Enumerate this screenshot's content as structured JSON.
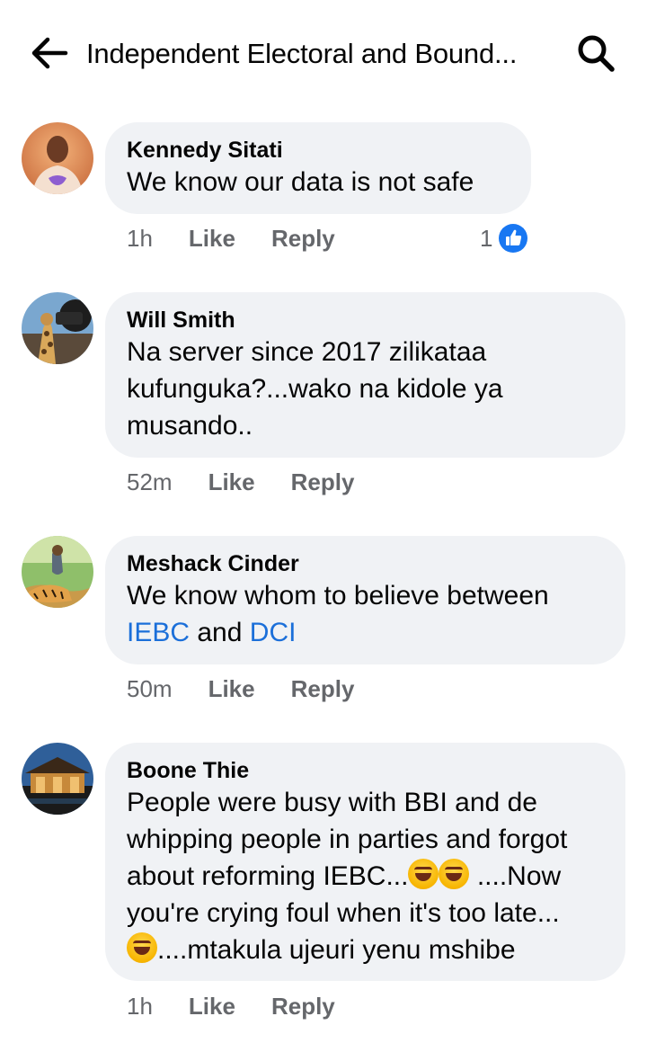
{
  "header": {
    "title": "Independent Electoral and Bound..."
  },
  "comments": [
    {
      "author": "Kennedy Sitati",
      "text": "We know our data is not safe",
      "time": "1h",
      "like_label": "Like",
      "reply_label": "Reply",
      "reaction_count": "1"
    },
    {
      "author": "Will Smith",
      "lines": [
        "Na server since 2017 zilikataa",
        "kufunguka?...wako na kidole ya",
        "musando.."
      ],
      "time": "52m",
      "like_label": "Like",
      "reply_label": "Reply"
    },
    {
      "author": "Meshack Cinder",
      "line1": "We know whom to believe between",
      "link1": "IEBC",
      "joiner": "and",
      "link2": "DCI",
      "time": "50m",
      "like_label": "Like",
      "reply_label": "Reply"
    },
    {
      "author": "Boone Thie",
      "lines": [
        "People were busy with BBI and de",
        "whipping people in parties and forgot",
        "about reforming IEBC...",
        " ....Now",
        "you're crying foul when it's too late...",
        "....mtakula ujeuri yenu mshibe"
      ],
      "time": "1h",
      "like_label": "Like",
      "reply_label": "Reply"
    }
  ],
  "colors": {
    "bubble": "#f0f2f5",
    "link": "#1b6fd9",
    "meta": "#65676b",
    "like_badge": "#1877f2"
  }
}
